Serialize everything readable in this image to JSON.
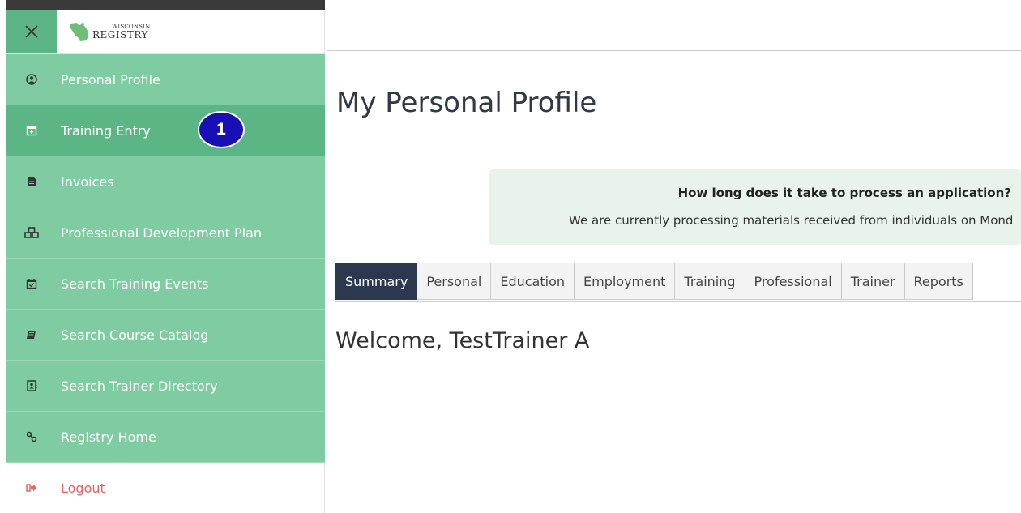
{
  "logo": {
    "small": "WISCONSIN",
    "big": "REGISTRY"
  },
  "sidebar": {
    "items": [
      {
        "label": "Personal Profile",
        "icon": "user-circle-icon"
      },
      {
        "label": "Training Entry",
        "icon": "calendar-plus-icon"
      },
      {
        "label": "Invoices",
        "icon": "file-icon"
      },
      {
        "label": "Professional Development Plan",
        "icon": "cubes-icon"
      },
      {
        "label": "Search Training Events",
        "icon": "calendar-check-icon"
      },
      {
        "label": "Search Course Catalog",
        "icon": "book-icon"
      },
      {
        "label": "Search Trainer Directory",
        "icon": "address-book-icon"
      },
      {
        "label": "Registry Home",
        "icon": "link-icon"
      },
      {
        "label": "Logout",
        "icon": "sign-out-icon"
      }
    ],
    "active_index": 1
  },
  "callout": {
    "number": "1"
  },
  "main": {
    "title": "My Personal Profile",
    "notice": {
      "heading": "How long does it take to process an application?",
      "body": "We are currently processing materials received from individuals on Mond"
    },
    "tabs": [
      "Summary",
      "Personal",
      "Education",
      "Employment",
      "Training",
      "Professional",
      "Trainer",
      "Reports"
    ],
    "active_tab": "Summary",
    "welcome": "Welcome, TestTrainer A"
  },
  "colors": {
    "sidebar_green": "#7fcba2",
    "active_green": "#5cb585",
    "badge_blue": "#1810b4",
    "tab_active": "#2c3750",
    "logout_red": "#e46464",
    "notice_bg": "#e8f3ec"
  }
}
